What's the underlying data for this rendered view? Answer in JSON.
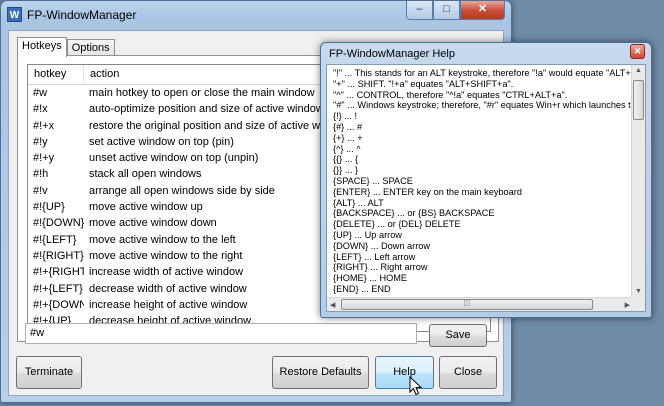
{
  "main_window": {
    "icon_letter": "W",
    "title": "FP-WindowManager",
    "caption": {
      "minimize": "–",
      "maximize": "□",
      "close": "✕"
    },
    "tabs": [
      {
        "label": "Hotkeys"
      },
      {
        "label": "Options"
      }
    ],
    "columns": [
      "hotkey",
      "action"
    ],
    "rows": [
      {
        "hotkey": "#w",
        "action": "main hotkey to open or close the main window"
      },
      {
        "hotkey": "#!x",
        "action": "auto-optimize position and size of active window"
      },
      {
        "hotkey": "#!+x",
        "action": "restore the original position and size of active window"
      },
      {
        "hotkey": "#!y",
        "action": "set active window on top (pin)"
      },
      {
        "hotkey": "#!+y",
        "action": "unset active window on top (unpin)"
      },
      {
        "hotkey": "#!h",
        "action": "stack all open windows"
      },
      {
        "hotkey": "#!v",
        "action": "arrange all open windows side by side"
      },
      {
        "hotkey": "#!{UP}",
        "action": "move active window up"
      },
      {
        "hotkey": "#!{DOWN}",
        "action": "move active window down"
      },
      {
        "hotkey": "#!{LEFT}",
        "action": "move active window to the left"
      },
      {
        "hotkey": "#!{RIGHT}",
        "action": "move active window to the right"
      },
      {
        "hotkey": "#!+{RIGHT}",
        "action": "increase width of active window"
      },
      {
        "hotkey": "#!+{LEFT}",
        "action": "decrease width of active window"
      },
      {
        "hotkey": "#!+{DOWN}",
        "action": "increase height of active window"
      },
      {
        "hotkey": "#!+{UP}",
        "action": "decrease height of active window"
      }
    ],
    "hotkey_value": "#w",
    "buttons": {
      "save": "Save",
      "terminate": "Terminate",
      "restore_defaults": "Restore Defaults",
      "help": "Help",
      "close": "Close"
    }
  },
  "help_window": {
    "title": "FP-WindowManager Help",
    "close": "✕",
    "lines": [
      "\"!\" ... This stands for an ALT keystroke, therefore \"!a\" would equate \"ALT+a\"",
      "\"+\" ... SHIFT. \"!+a\" equates \"ALT+SHIFT+a\".",
      "\"^\" ... CONTROL, therefore \"^!a\" equates \"CTRL+ALT+a\".",
      "\"#\" ... Windows keystroke; therefore, \"#r\" equates Win+r which launches the",
      "{!} ... !",
      "{#} ... #",
      "{+} ... +",
      "{^} ... ^",
      "{{} ... {",
      "{}} ... }",
      "{SPACE} ... SPACE",
      "{ENTER} ... ENTER key on the main keyboard",
      "{ALT} ... ALT",
      "{BACKSPACE} ... or {BS} BACKSPACE",
      "{DELETE} ... or {DEL} DELETE",
      "{UP} ... Up arrow",
      "{DOWN} ... Down arrow",
      "{LEFT} ... Left arrow",
      "{RIGHT} ... Right arrow",
      "{HOME} ... HOME",
      "{END} ... END"
    ]
  }
}
